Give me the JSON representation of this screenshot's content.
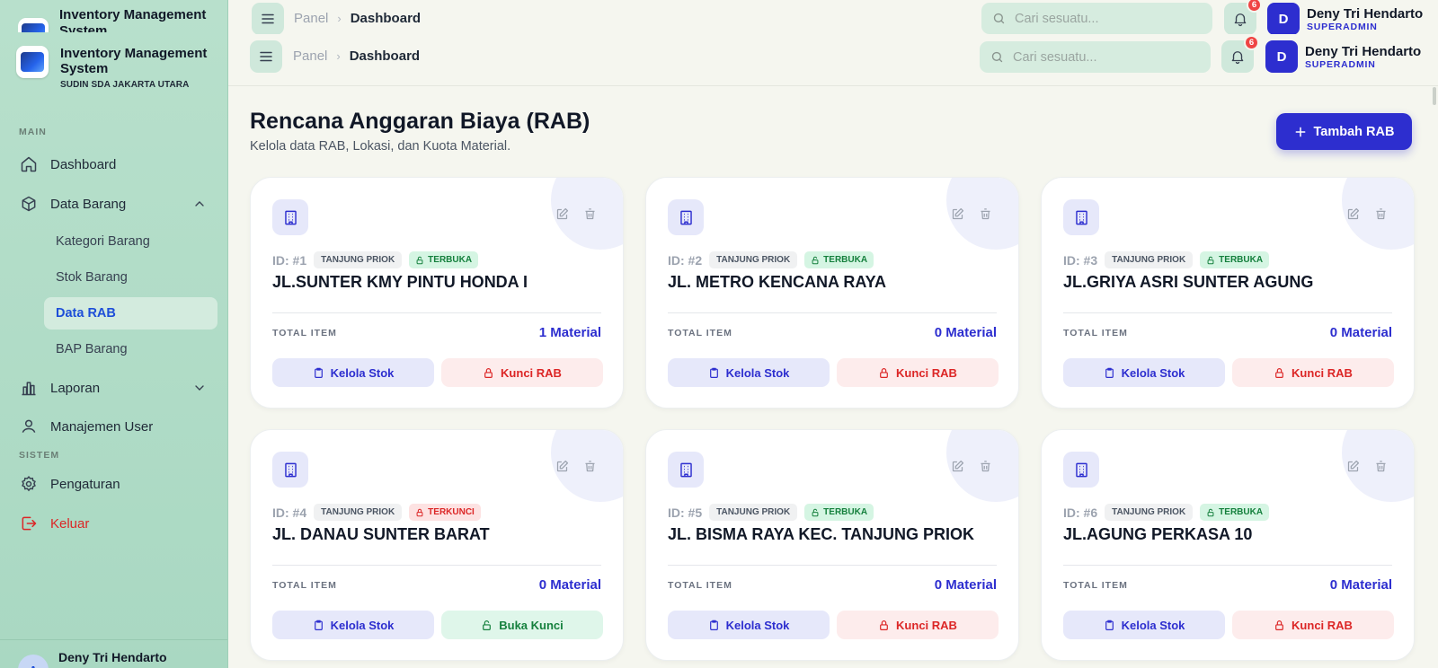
{
  "app": {
    "title": "Inventory Management System",
    "subtitle": "SUDIN SDA JAKARTA UTARA"
  },
  "sidebar": {
    "section_main": "MAIN",
    "section_system": "SISTEM",
    "dashboard": "Dashboard",
    "data_barang": "Data Barang",
    "kategori": "Kategori Barang",
    "stok": "Stok Barang",
    "data_rab": "Data RAB",
    "bap": "BAP Barang",
    "laporan": "Laporan",
    "manajemen": "Manajemen User",
    "pengaturan": "Pengaturan",
    "keluar": "Keluar",
    "footer_initial": "A",
    "footer_name": "Deny Tri Hendarto"
  },
  "header": {
    "crumb_root": "Panel",
    "crumb_current": "Dashboard",
    "search_placeholder": "Cari sesuatu...",
    "notif_count": "6",
    "user_initial": "D",
    "user_name": "Deny Tri Hendarto",
    "user_role": "SUPERADMIN"
  },
  "page": {
    "title": "Rencana Anggaran Biaya (RAB)",
    "subtitle": "Kelola data RAB, Lokasi, dan Kuota Material.",
    "add_button": "Tambah RAB"
  },
  "labels": {
    "total_item": "TOTAL ITEM",
    "kelola": "Kelola Stok",
    "kunci": "Kunci RAB",
    "buka": "Buka Kunci"
  },
  "cards": [
    {
      "id": "ID: #1",
      "location": "TANJUNG PRIOK",
      "status": "TERBUKA",
      "locked": false,
      "name": "JL.SUNTER KMY PINTU HONDA I",
      "materials": "1 Material"
    },
    {
      "id": "ID: #2",
      "location": "TANJUNG PRIOK",
      "status": "TERBUKA",
      "locked": false,
      "name": "JL. METRO KENCANA RAYA",
      "materials": "0 Material"
    },
    {
      "id": "ID: #3",
      "location": "TANJUNG PRIOK",
      "status": "TERBUKA",
      "locked": false,
      "name": "JL.GRIYA ASRI SUNTER AGUNG",
      "materials": "0 Material"
    },
    {
      "id": "ID: #4",
      "location": "TANJUNG PRIOK",
      "status": "TERKUNCI",
      "locked": true,
      "name": "JL. DANAU SUNTER BARAT",
      "materials": "0 Material"
    },
    {
      "id": "ID: #5",
      "location": "TANJUNG PRIOK",
      "status": "TERBUKA",
      "locked": false,
      "name": "JL. BISMA RAYA KEC. TANJUNG PRIOK",
      "materials": "0 Material"
    },
    {
      "id": "ID: #6",
      "location": "TANJUNG PRIOK",
      "status": "TERBUKA",
      "locked": false,
      "name": "JL.AGUNG PERKASA 10",
      "materials": "0 Material"
    }
  ],
  "colors": {
    "accent": "#2d2ecf",
    "sidebar_bg": "#b8e0cc",
    "danger": "#dc2626",
    "success": "#15803d"
  }
}
